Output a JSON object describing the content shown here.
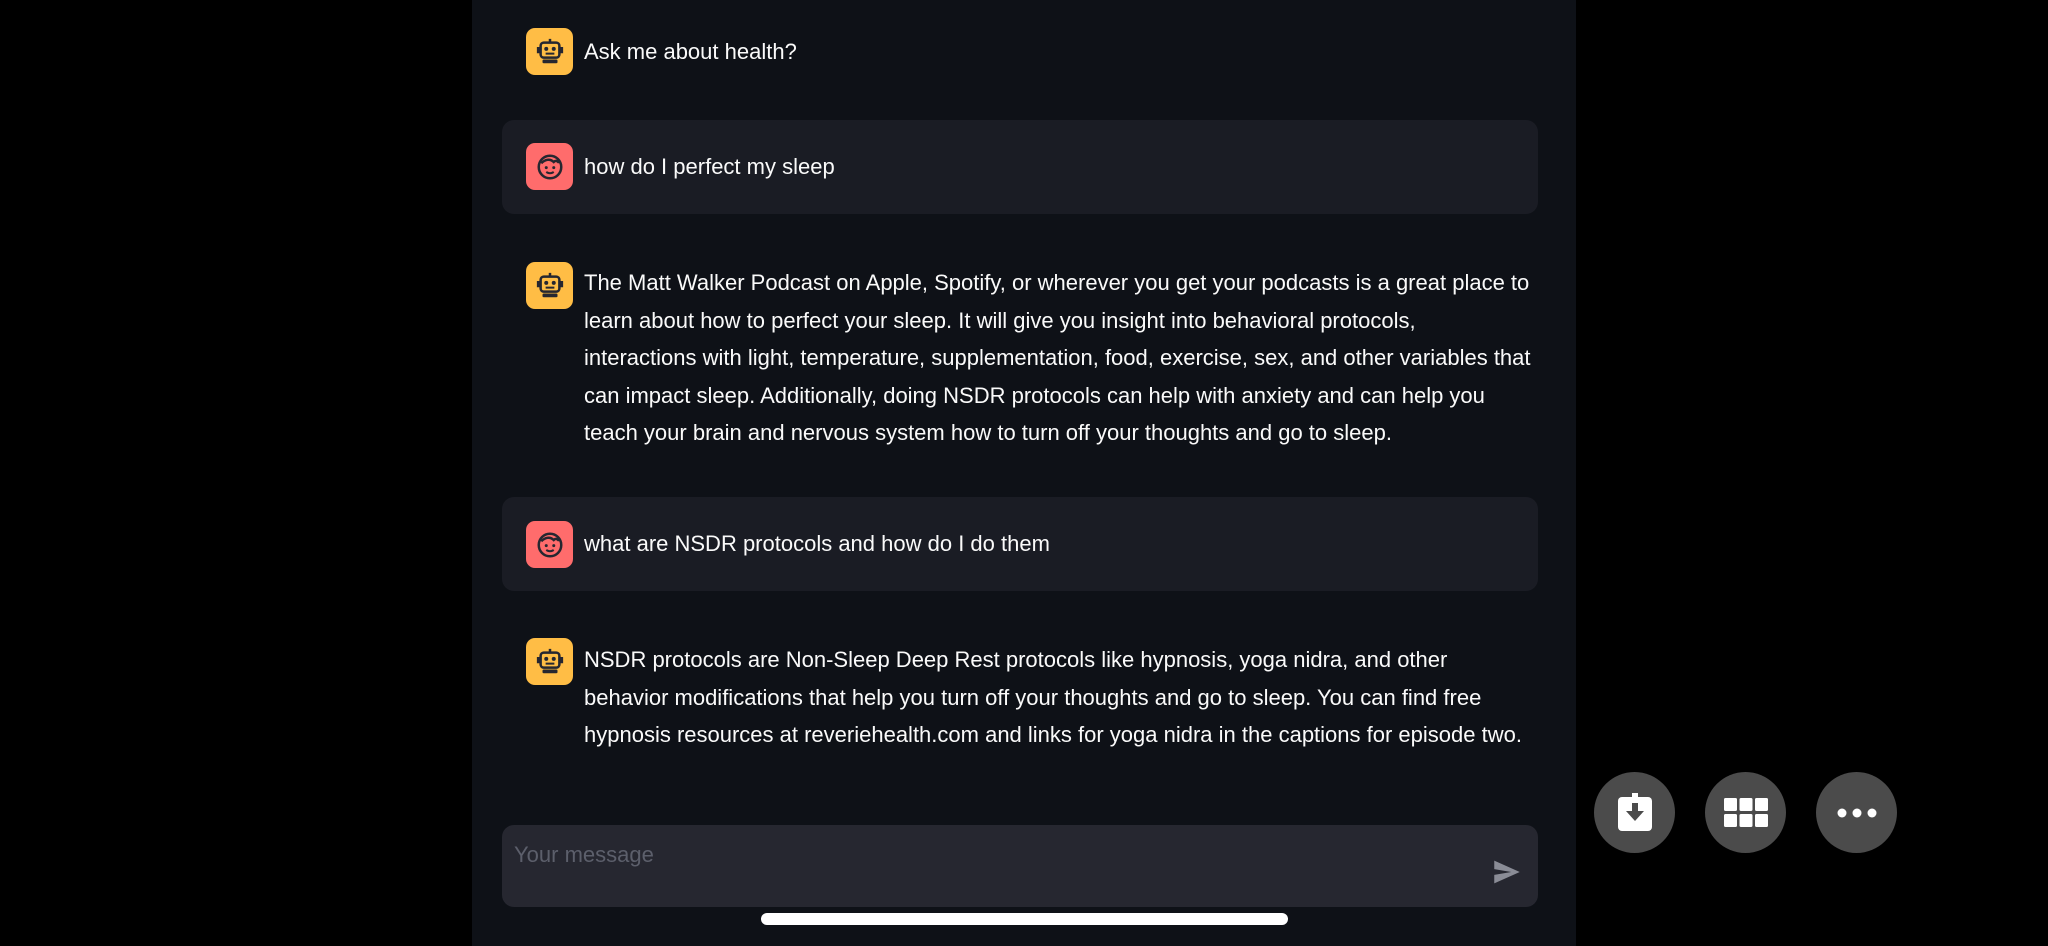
{
  "chat": {
    "messages": [
      {
        "role": "assistant",
        "text": "Ask me about health?"
      },
      {
        "role": "user",
        "text": "how do I perfect my sleep"
      },
      {
        "role": "assistant",
        "text": "The Matt Walker Podcast on Apple, Spotify, or wherever you get your podcasts is a great place to learn about how to perfect your sleep. It will give you insight into behavioral protocols, interactions with light, temperature, supplementation, food, exercise, sex, and other variables that can impact sleep. Additionally, doing NSDR protocols can help with anxiety and can help you teach your brain and nervous system how to turn off your thoughts and go to sleep."
      },
      {
        "role": "user",
        "text": "what are NSDR protocols and how do I do them"
      },
      {
        "role": "assistant",
        "text": "NSDR protocols are Non-Sleep Deep Rest protocols like hypnosis, yoga nidra, and other behavior modifications that help you turn off your thoughts and go to sleep. You can find free hypnosis resources at reveriehealth.com and links for yoga nidra in the captions for episode two."
      }
    ]
  },
  "input": {
    "placeholder": "Your message",
    "value": ""
  },
  "icons": {
    "assistant_avatar": "robot-icon",
    "user_avatar": "face-icon",
    "send": "send-icon",
    "fabs": [
      "download-icon",
      "grid-icon",
      "more-icon"
    ]
  },
  "colors": {
    "background": "#0e1117",
    "assistant_avatar": "#ffbd45",
    "user_avatar": "#ff6c6c",
    "user_bubble": "#1a1c24",
    "input": "#262730",
    "text": "#fafafa"
  }
}
